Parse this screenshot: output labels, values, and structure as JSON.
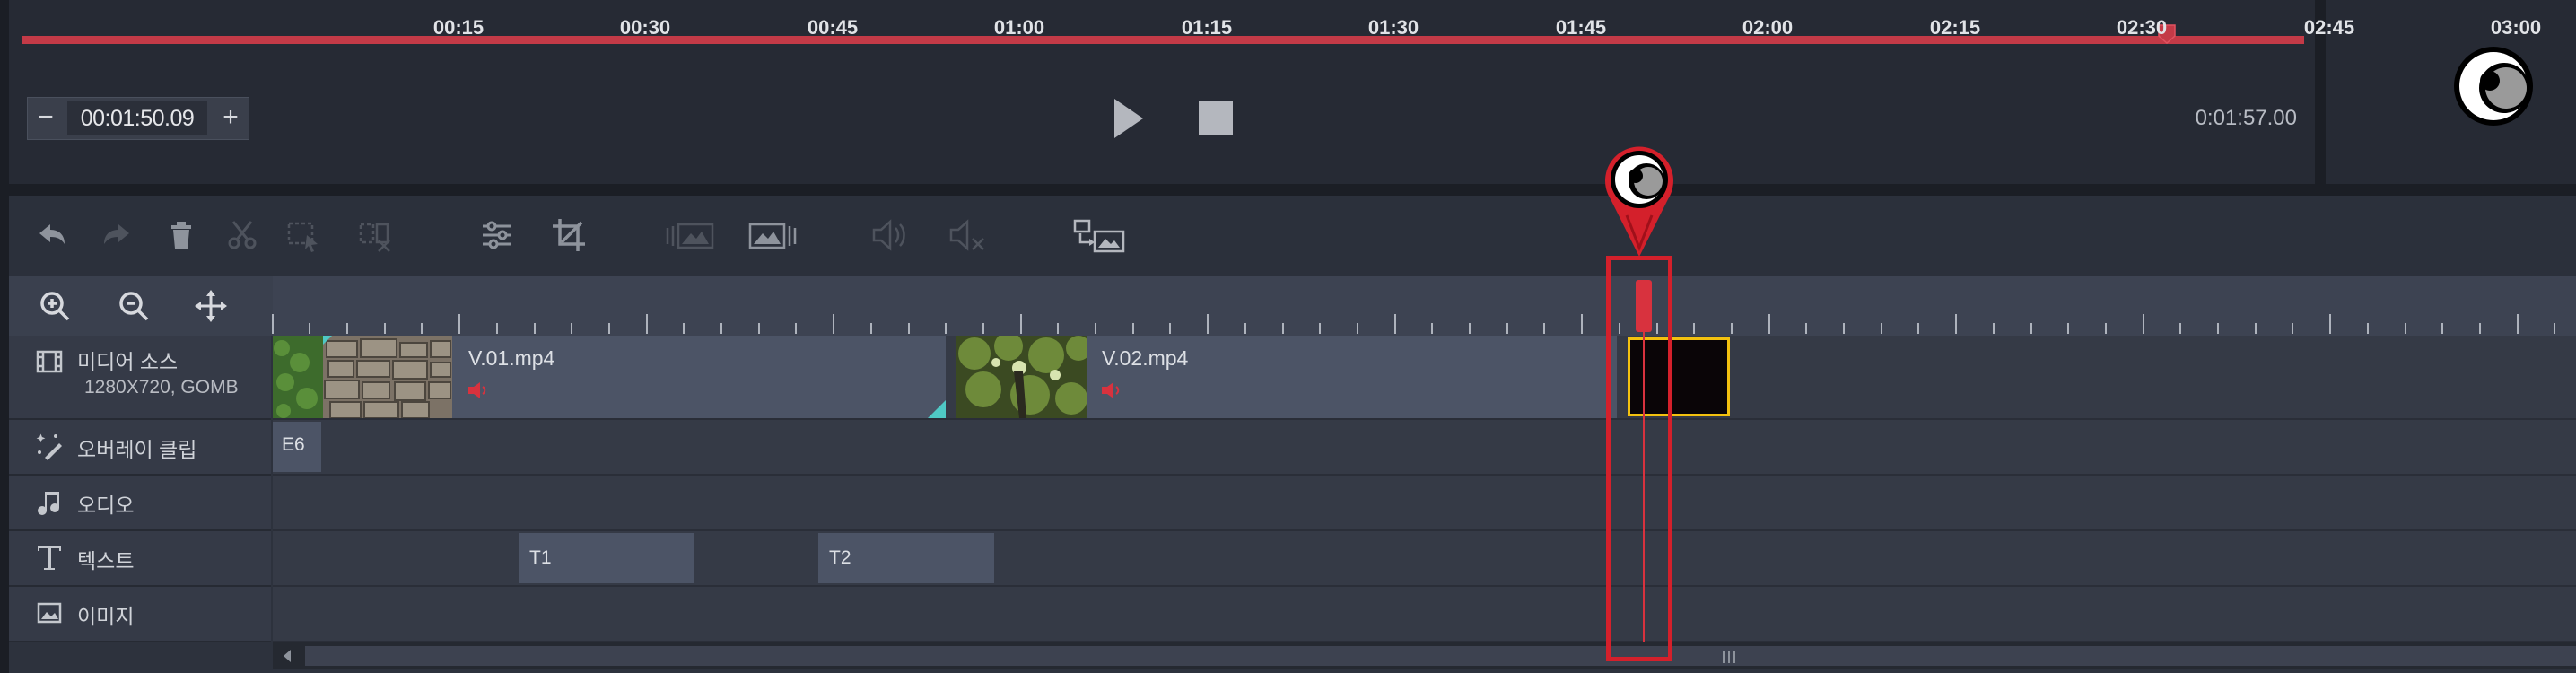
{
  "preview": {
    "timecode": "00:01:50.09",
    "timecode_minus": "−",
    "timecode_plus": "+",
    "duration": "0:01:57.00",
    "play_icon": "play-icon",
    "stop_icon": "stop-icon",
    "seek_progress": 0.94,
    "seek_color": "#c33a47"
  },
  "toolbar": {
    "tools": [
      "undo-icon",
      "redo-icon",
      "delete-icon",
      "cut-icon",
      "select-icon",
      "split-icon",
      "adjust-icon",
      "crop-icon",
      "image-before-icon",
      "image-after-icon",
      "audio-icon",
      "mute-icon",
      "swap-media-icon"
    ]
  },
  "zoom": {
    "tools": [
      "zoom-in-icon",
      "zoom-out-icon",
      "fit-icon"
    ]
  },
  "ruler": {
    "labels": [
      "00:15",
      "00:30",
      "00:45",
      "01:00",
      "01:15",
      "01:30",
      "01:45",
      "02:00",
      "02:15",
      "02:30",
      "02:45",
      "03:00"
    ]
  },
  "tracks": {
    "media": {
      "label": "미디어 소스",
      "sublabel": "1280X720, GOMB"
    },
    "overlay": {
      "label": "오버레이 클립"
    },
    "audio": {
      "label": "오디오"
    },
    "text": {
      "label": "텍스트"
    },
    "image": {
      "label": "이미지"
    }
  },
  "clips": {
    "video1": "V.01.mp4",
    "video2": "V.02.mp4",
    "overlay1": "E6",
    "text1": "T1",
    "text2": "T2"
  },
  "colors": {
    "accent": "#d4202b",
    "selection": "#f3c10f",
    "panel": "#2d323d"
  }
}
